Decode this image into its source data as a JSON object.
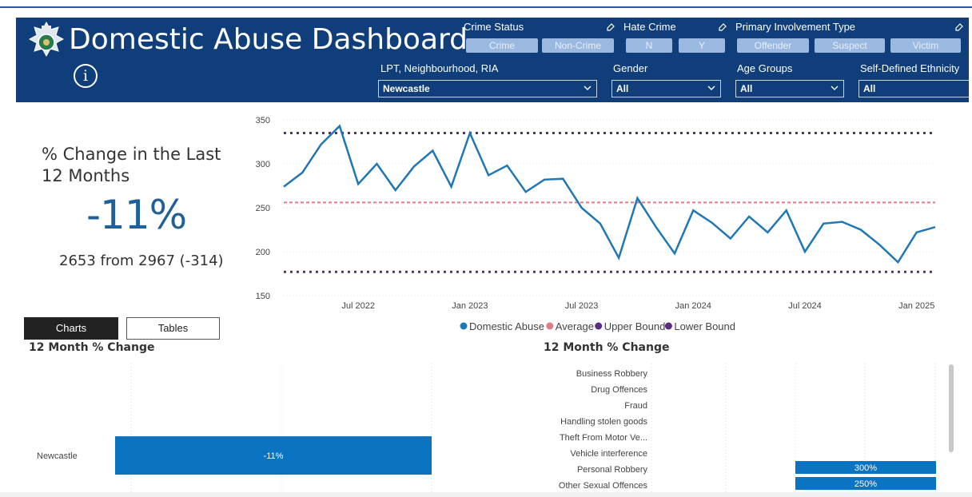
{
  "header": {
    "title": "Domestic Abuse Dashboard",
    "info_icon": "i",
    "colors": {
      "background": "#0f3e7a",
      "chip": "#9ab8e0"
    }
  },
  "slicers": {
    "crime_status": {
      "label": "Crime Status",
      "options": [
        "Crime",
        "Non-Crime"
      ]
    },
    "hate_crime": {
      "label": "Hate Crime",
      "options": [
        "N",
        "Y"
      ]
    },
    "involvement": {
      "label": "Primary Involvement Type",
      "options": [
        "Offender",
        "Suspect",
        "Victim"
      ]
    },
    "area": {
      "label": "LPT, Neighbourhood, RIA",
      "value": "Newcastle"
    },
    "gender": {
      "label": "Gender",
      "value": "All"
    },
    "age": {
      "label": "Age Groups",
      "value": "All"
    },
    "ethnicity": {
      "label": "Self-Defined Ethnicity",
      "value": "All"
    }
  },
  "kpi": {
    "title": "% Change in the Last 12 Months",
    "value": "-11%",
    "detail": "2653 from 2967 (-314)"
  },
  "tabs": {
    "charts": "Charts",
    "tables": "Tables"
  },
  "left_chart": {
    "title": "12 Month % Change"
  },
  "right_chart": {
    "title": "12 Month % Change"
  },
  "chart_data": [
    {
      "type": "line",
      "x_ticks": [
        "Jul 2022",
        "Jan 2023",
        "Jul 2023",
        "Jan 2024",
        "Jul 2024",
        "Jan 2025"
      ],
      "y_ticks": [
        150,
        200,
        250,
        300,
        350
      ],
      "ylim": [
        150,
        350
      ],
      "x_start": "2022-03",
      "series": [
        {
          "name": "Domestic Abuse",
          "color": "#1f77b4",
          "values": [
            274,
            290,
            322,
            343,
            277,
            300,
            270,
            297,
            315,
            274,
            335,
            287,
            298,
            268,
            282,
            283,
            250,
            232,
            193,
            261,
            228,
            198,
            247,
            233,
            215,
            240,
            222,
            247,
            200,
            232,
            234,
            225,
            208,
            188,
            222,
            228
          ]
        },
        {
          "name": "Average",
          "color": "#e07a86",
          "values": [
            256
          ]
        },
        {
          "name": "Upper Bound",
          "color": "#5b2c83",
          "values": [
            335
          ]
        },
        {
          "name": "Lower Bound",
          "color": "#5b2c83",
          "values": [
            177
          ]
        }
      ]
    },
    {
      "type": "bar",
      "orientation": "horizontal",
      "categories": [
        "Newcastle"
      ],
      "values": [
        -11
      ],
      "labels": [
        "-11%"
      ],
      "color": "#0a73c2"
    },
    {
      "type": "bar",
      "orientation": "horizontal",
      "categories": [
        "Business Robbery",
        "Drug Offences",
        "Fraud",
        "Handling stolen goods",
        "Theft From Motor Ve...",
        "Vehicle interference",
        "Personal Robbery",
        "Other Sexual Offences"
      ],
      "values": [
        null,
        null,
        null,
        null,
        null,
        null,
        300,
        250
      ],
      "labels": [
        "",
        "",
        "",
        "",
        "",
        "",
        "300%",
        "250%"
      ],
      "color": "#0a73c2"
    }
  ]
}
